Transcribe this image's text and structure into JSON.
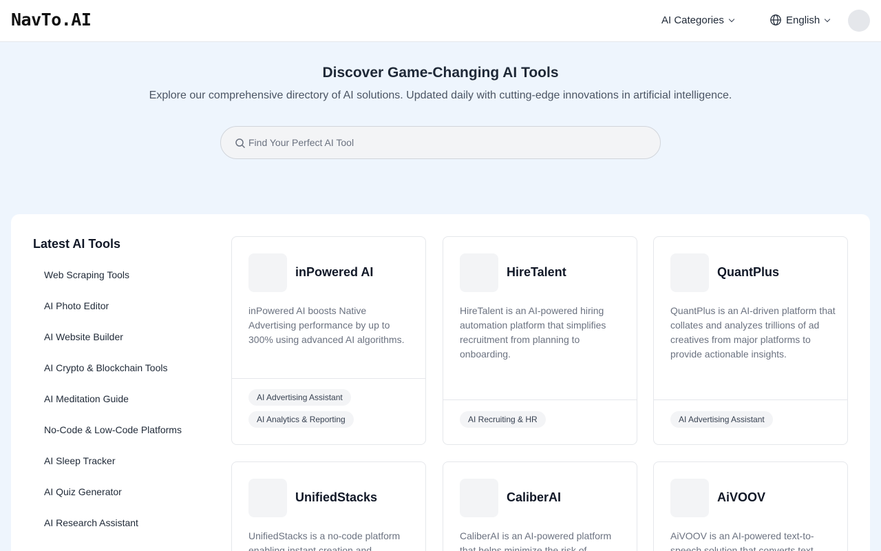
{
  "header": {
    "logo": "NavTo.AI",
    "categories_label": "AI Categories",
    "language_label": "English"
  },
  "hero": {
    "title": "Discover Game-Changing AI Tools",
    "subtitle": "Explore our comprehensive directory of AI solutions. Updated daily with cutting-edge innovations in artificial intelligence.",
    "search_placeholder": "Find Your Perfect AI Tool"
  },
  "sidebar": {
    "title": "Latest AI Tools",
    "items": [
      {
        "label": "Web Scraping Tools"
      },
      {
        "label": "AI Photo Editor"
      },
      {
        "label": "AI Website Builder"
      },
      {
        "label": "AI Crypto & Blockchain Tools"
      },
      {
        "label": "AI Meditation Guide"
      },
      {
        "label": "No-Code & Low-Code Platforms"
      },
      {
        "label": "AI Sleep Tracker"
      },
      {
        "label": "AI Quiz Generator"
      },
      {
        "label": "AI Research Assistant"
      }
    ]
  },
  "tools": [
    {
      "name": "inPowered AI",
      "description": "inPowered AI boosts Native Advertising performance by up to 300% using advanced AI algorithms.",
      "tags": [
        "AI Advertising Assistant",
        "AI Analytics & Reporting"
      ]
    },
    {
      "name": "HireTalent",
      "description": "HireTalent is an AI-powered hiring automation platform that simplifies recruitment from planning to onboarding.",
      "tags": [
        "AI Recruiting & HR"
      ]
    },
    {
      "name": "QuantPlus",
      "description": "QuantPlus is an AI-driven platform that collates and analyzes trillions of ad creatives from major platforms to provide actionable insights.",
      "tags": [
        "AI Advertising Assistant"
      ]
    },
    {
      "name": "UnifiedStacks",
      "description": "UnifiedStacks is a no-code platform enabling instant creation and",
      "tags": []
    },
    {
      "name": "CaliberAI",
      "description": "CaliberAI is an AI-powered platform that helps minimize the risk of",
      "tags": []
    },
    {
      "name": "AiVOOV",
      "description": "AiVOOV is an AI-powered text-to-speech solution that converts text",
      "tags": []
    }
  ]
}
